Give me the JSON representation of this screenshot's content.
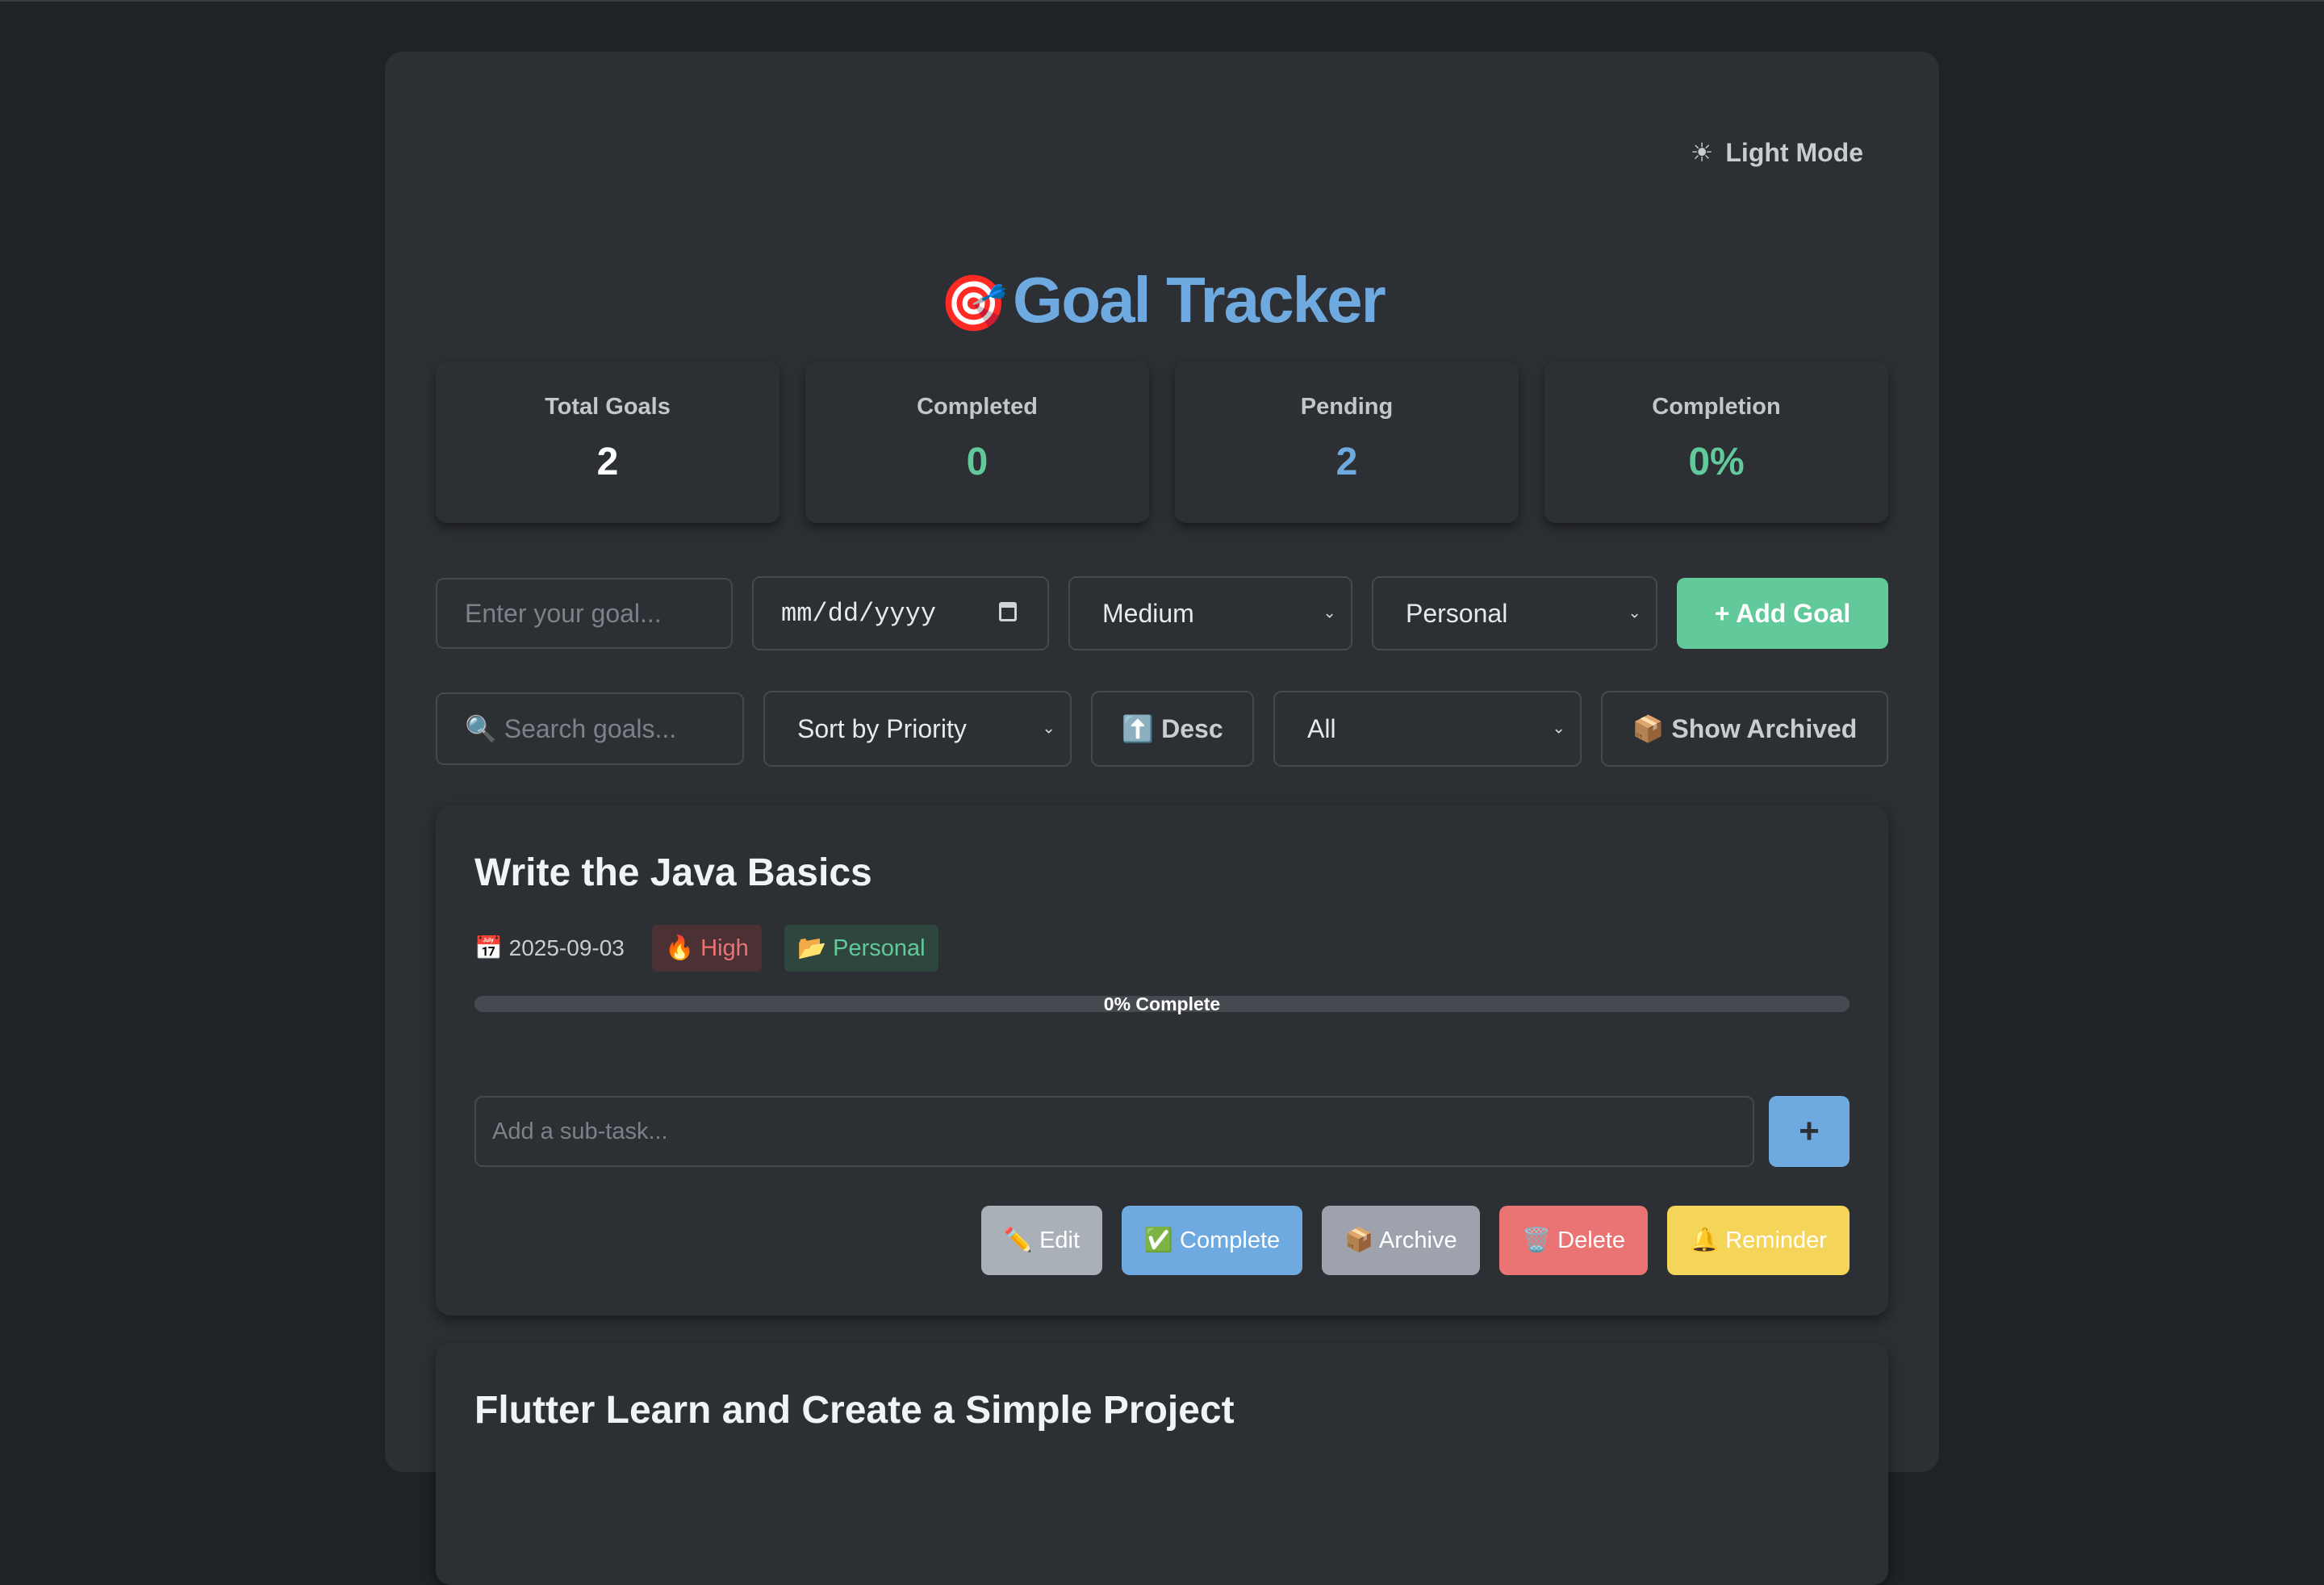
{
  "header": {
    "mode_icon": "☀",
    "mode_label": "Light Mode",
    "title_icon": "🎯",
    "title": "Goal Tracker"
  },
  "stats": [
    {
      "label": "Total Goals",
      "value": "2",
      "color": "#ffffff"
    },
    {
      "label": "Completed",
      "value": "0",
      "color": "#62c99a"
    },
    {
      "label": "Pending",
      "value": "2",
      "color": "#6ea9df"
    },
    {
      "label": "Completion",
      "value": "0%",
      "color": "#62c99a"
    }
  ],
  "add_form": {
    "goal_placeholder": "Enter your goal...",
    "date_placeholder": "mm/dd/yyyy",
    "priority_value": "Medium",
    "category_value": "Personal",
    "add_label": "+ Add Goal"
  },
  "filters": {
    "search_placeholder": "🔍 Search goals...",
    "sort_value": "Sort by Priority",
    "order_label": "⬆️ Desc",
    "status_value": "All",
    "archived_label": "📦 Show Archived"
  },
  "goals": [
    {
      "title": "Write the Java Basics",
      "date": "📅 2025-09-03",
      "priority": "🔥 High",
      "category": "📂 Personal",
      "progress_label": "0% Complete",
      "progress": 0,
      "subtask_placeholder": "Add a sub-task...",
      "subtask_add": "+",
      "actions": {
        "edit": "✏️ Edit",
        "complete": "✅ Complete",
        "archive": "📦 Archive",
        "delete": "🗑️ Delete",
        "reminder": "🔔 Reminder"
      }
    },
    {
      "title": "Flutter Learn and Create a Simple Project"
    }
  ],
  "colors": {
    "page_bg": "#1f2227",
    "panel_bg": "#2c2f34",
    "accent_blue": "#6ea9df",
    "accent_green": "#62c99a",
    "edit": "#aab0b8",
    "complete": "#6ea9df",
    "archive": "#9ea2ad",
    "delete": "#ea7373",
    "reminder": "#f5d45a"
  }
}
